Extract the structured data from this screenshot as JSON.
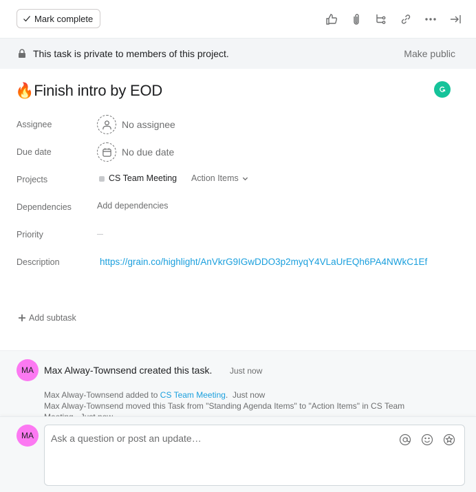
{
  "toolbar": {
    "mark_complete_label": "Mark complete",
    "icons": [
      "thumbs-up-icon",
      "paperclip-icon",
      "subtask-icon",
      "link-icon",
      "more-icon",
      "close-pane-icon"
    ]
  },
  "privacy": {
    "message": "This task is private to members of this project.",
    "action_label": "Make public"
  },
  "task": {
    "title": "🔥Finish intro by EOD"
  },
  "fields": {
    "assignee": {
      "label": "Assignee",
      "value": "No assignee"
    },
    "due_date": {
      "label": "Due date",
      "value": "No due date"
    },
    "projects": {
      "label": "Projects",
      "project_name": "CS Team Meeting",
      "section": "Action Items"
    },
    "dependencies": {
      "label": "Dependencies",
      "action": "Add dependencies"
    },
    "priority": {
      "label": "Priority",
      "value": "—"
    },
    "description": {
      "label": "Description",
      "value": "https://grain.co/highlight/AnVkrG9IGwDDO3p2myqY4VLaUrEQh6PA4NWkC1Ef"
    }
  },
  "subtasks": {
    "add_label": "Add subtask"
  },
  "activity": {
    "avatar_initials": "MA",
    "avatar_color": "#fc79f2",
    "created": {
      "text": "Max Alway-Townsend created this task.",
      "time": "Just now"
    },
    "entries": [
      {
        "actor": "Max Alway-Townsend",
        "action": " added to ",
        "link": "CS Team Meeting",
        "suffix": ".",
        "time": "Just now"
      },
      {
        "actor": "Max Alway-Townsend",
        "action": " moved this Task from \"Standing Agenda Items\" to \"Action Items\" in CS Team Meeting.",
        "time": "Just now"
      }
    ]
  },
  "composer": {
    "avatar_initials": "MA",
    "placeholder": "Ask a question or post an update…",
    "icons": [
      "mention-icon",
      "emoji-icon",
      "star-icon"
    ]
  },
  "colors": {
    "link": "#1a9fdd",
    "grammarly": "#15c39a",
    "avatar": "#fc79f2"
  }
}
